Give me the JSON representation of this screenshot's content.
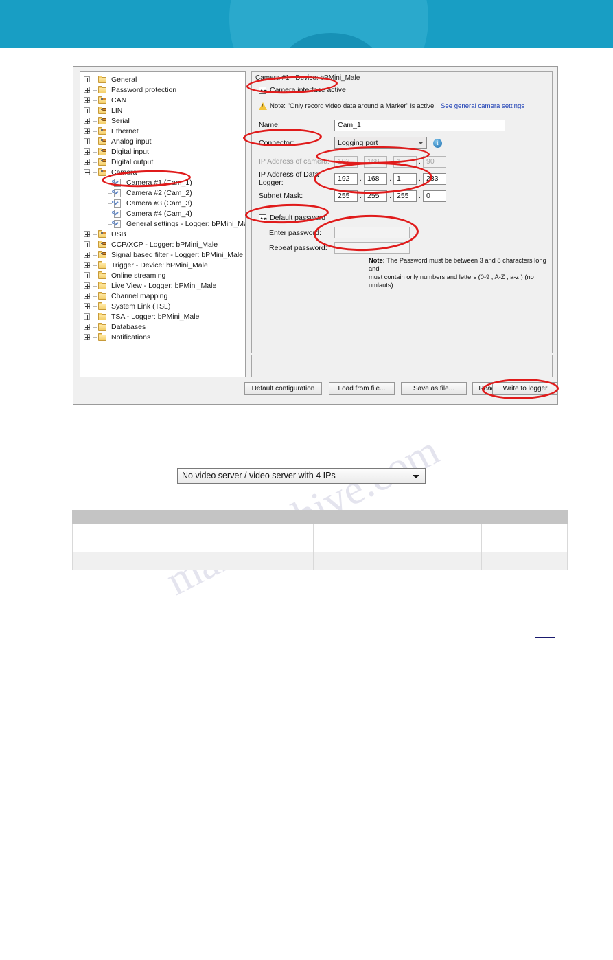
{
  "banner": {
    "accent": "#189ec4",
    "accent_light": "#2aa9cc"
  },
  "tree": {
    "nodes": [
      {
        "label": "General",
        "icon": "folder-icon",
        "depth": 0,
        "expander": "plus",
        "selected": false
      },
      {
        "label": "Password protection",
        "icon": "folder-icon",
        "depth": 0,
        "expander": "plus",
        "selected": false
      },
      {
        "label": "CAN",
        "icon": "folder-plug-icon",
        "depth": 0,
        "expander": "plus",
        "selected": false
      },
      {
        "label": "LIN",
        "icon": "folder-plug-icon",
        "depth": 0,
        "expander": "plus",
        "selected": false
      },
      {
        "label": "Serial",
        "icon": "folder-plug-icon",
        "depth": 0,
        "expander": "plus",
        "selected": false
      },
      {
        "label": "Ethernet",
        "icon": "folder-plug-icon",
        "depth": 0,
        "expander": "plus",
        "selected": false
      },
      {
        "label": "Analog input",
        "icon": "folder-plug-icon",
        "depth": 0,
        "expander": "plus",
        "selected": false
      },
      {
        "label": "Digital input",
        "icon": "folder-plug-icon",
        "depth": 0,
        "expander": "plus",
        "selected": false
      },
      {
        "label": "Digital output",
        "icon": "folder-plug-icon",
        "depth": 0,
        "expander": "plus",
        "selected": false
      },
      {
        "label": "Camera",
        "icon": "folder-plug-icon",
        "depth": 0,
        "expander": "minus",
        "selected": false
      },
      {
        "label": "Camera #1 (Cam_1)",
        "icon": "wrench-page-icon",
        "depth": 1,
        "expander": "none",
        "selected": true
      },
      {
        "label": "Camera #2 (Cam_2)",
        "icon": "wrench-page-icon",
        "depth": 1,
        "expander": "none",
        "selected": false
      },
      {
        "label": "Camera #3 (Cam_3)",
        "icon": "wrench-page-icon",
        "depth": 1,
        "expander": "none",
        "selected": false
      },
      {
        "label": "Camera #4 (Cam_4)",
        "icon": "wrench-page-icon",
        "depth": 1,
        "expander": "none",
        "selected": false
      },
      {
        "label": "General settings - Logger: bPMini_Male",
        "icon": "wrench-page-icon",
        "depth": 1,
        "expander": "none",
        "selected": false
      },
      {
        "label": "USB",
        "icon": "folder-plug-icon",
        "depth": 0,
        "expander": "plus",
        "selected": false
      },
      {
        "label": "CCP/XCP - Logger: bPMini_Male",
        "icon": "folder-plug-icon",
        "depth": 0,
        "expander": "plus",
        "selected": false
      },
      {
        "label": "Signal based filter - Logger: bPMini_Male",
        "icon": "folder-plug-icon",
        "depth": 0,
        "expander": "plus",
        "selected": false
      },
      {
        "label": "Trigger - Device: bPMini_Male",
        "icon": "folder-icon",
        "depth": 0,
        "expander": "plus",
        "selected": false
      },
      {
        "label": "Online streaming",
        "icon": "folder-icon",
        "depth": 0,
        "expander": "plus",
        "selected": false
      },
      {
        "label": "Live View - Logger: bPMini_Male",
        "icon": "folder-icon",
        "depth": 0,
        "expander": "plus",
        "selected": false
      },
      {
        "label": "Channel mapping",
        "icon": "folder-icon",
        "depth": 0,
        "expander": "plus",
        "selected": false
      },
      {
        "label": "System Link (TSL)",
        "icon": "folder-icon",
        "depth": 0,
        "expander": "plus",
        "selected": false
      },
      {
        "label": "TSA - Logger: bPMini_Male",
        "icon": "folder-icon",
        "depth": 0,
        "expander": "plus",
        "selected": false
      },
      {
        "label": "Databases",
        "icon": "folder-icon",
        "depth": 0,
        "expander": "plus",
        "selected": false
      },
      {
        "label": "Notifications",
        "icon": "folder-icon",
        "depth": 0,
        "expander": "plus",
        "selected": false
      }
    ]
  },
  "settings": {
    "title": "Camera #1 - Device: bPMini_Male",
    "interface_active_label": "Camera interface active",
    "interface_active_checked": true,
    "note_text": "Note: \"Only record video data around a Marker\" is active!",
    "note_link": "See general camera settings",
    "name_label": "Name:",
    "name_value": "Cam_1",
    "connector_label": "Connector:",
    "connector_value": "Logging port",
    "info_icon": "info-icon",
    "camera_ip_label": "IP Address of camera:",
    "camera_ip": [
      "192",
      "168",
      "1",
      "90"
    ],
    "camera_ip_readonly": true,
    "logger_ip_label": "IP Address of Data Logger:",
    "logger_ip": [
      "192",
      "168",
      "1",
      "233"
    ],
    "subnet_label": "Subnet Mask:",
    "subnet": [
      "255",
      "255",
      "255",
      "0"
    ],
    "default_password_label": "Default password",
    "default_password_checked": true,
    "enter_password_label": "Enter password:",
    "enter_password_value": "",
    "repeat_password_label": "Repeat password:",
    "repeat_password_value": "",
    "password_note_bold": "Note:",
    "password_note_line1": " The Password must be between 3 and 8 characters long and",
    "password_note_line2": "must contain only numbers and letters (0-9 , A-Z , a-z ) (no umlauts)"
  },
  "buttons": {
    "default_configuration": "Default configuration",
    "load_from_file": "Load from file...",
    "save_as_file": "Save as file...",
    "read_from_logger": "Read from logger",
    "write_to_logger": "Write to logger"
  },
  "video_server_dropdown": {
    "selected": "No video server / video server with 4 IPs"
  },
  "table": {
    "columns": [
      "",
      "",
      "",
      "",
      ""
    ],
    "rows": [
      [
        "",
        "",
        "",
        "",
        ""
      ],
      [
        "",
        "",
        "",
        "",
        ""
      ]
    ]
  },
  "annotations": {
    "highlight_color": "#e01b1b",
    "ellipses": [
      "camera-interface-active",
      "connector-label",
      "camera-ip-fields",
      "logger-ip-and-subnet-fields",
      "default-password-checkbox",
      "password-fields",
      "write-to-logger-button"
    ]
  },
  "watermark": {
    "text": "manualshive.com"
  }
}
